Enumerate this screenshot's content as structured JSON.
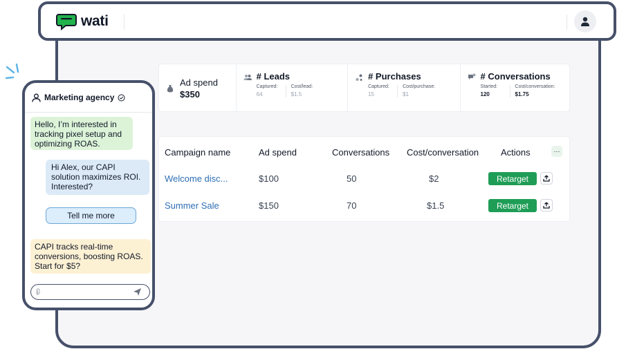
{
  "app": {
    "logo_text": "wati",
    "accent_color": "#22b24c",
    "frame_color": "#46506a"
  },
  "header": {
    "avatar_icon": "user-icon"
  },
  "stats": {
    "ad_spend": {
      "label": "Ad spend",
      "value": "$350",
      "icon": "money-bag-icon"
    },
    "leads": {
      "title": "# Leads",
      "sub1_label": "Captured:",
      "sub1_value": "64",
      "sub2_label": "Cost/lead:",
      "sub2_value": "$1.5",
      "icon": "people-icon"
    },
    "purchases": {
      "title": "# Purchases",
      "sub1_label": "Captured:",
      "sub1_value": "15",
      "sub2_label": "Cost/purchase:",
      "sub2_value": "$1",
      "icon": "cart-icon"
    },
    "conversations": {
      "title": "# Conversations",
      "sub1_label": "Started:",
      "sub1_value": "120",
      "sub2_label": "Cost/conversation:",
      "sub2_value": "$1.75",
      "icon": "chat-icon"
    }
  },
  "table": {
    "columns": [
      "Campaign name",
      "Ad spend",
      "Conversations",
      "Cost/conversation",
      "Actions"
    ],
    "more_label": "···",
    "rows": [
      {
        "name": "Welcome disc...",
        "ad_spend": "$100",
        "conversations": "50",
        "cost": "$2",
        "action": "Retarget"
      },
      {
        "name": "Summer Sale",
        "ad_spend": "$150",
        "conversations": "70",
        "cost": "$1.5",
        "action": "Retarget"
      }
    ]
  },
  "chat": {
    "title": "Marketing agency",
    "messages": [
      "Hello, I’m interested in tracking pixel setup and optimizing ROAS.",
      "Hi Alex, our CAPI solution maximizes ROI. Interested?",
      "CAPI tracks real-time conversions, boosting ROAS. Start for $5?"
    ],
    "quick_reply": "Tell me more",
    "input_value": ""
  }
}
